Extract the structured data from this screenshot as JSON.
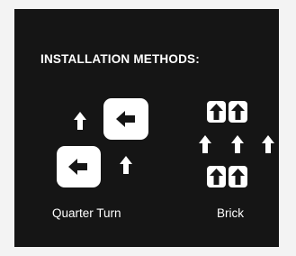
{
  "heading": "INSTALLATION METHODS:",
  "methods": [
    {
      "label": "Quarter Turn",
      "icon": "quarter-turn-pattern-icon"
    },
    {
      "label": "Brick",
      "icon": "brick-pattern-icon"
    }
  ],
  "colors": {
    "page_background": "#f3f3f3",
    "panel_background": "#151515",
    "foreground": "#ffffff"
  }
}
